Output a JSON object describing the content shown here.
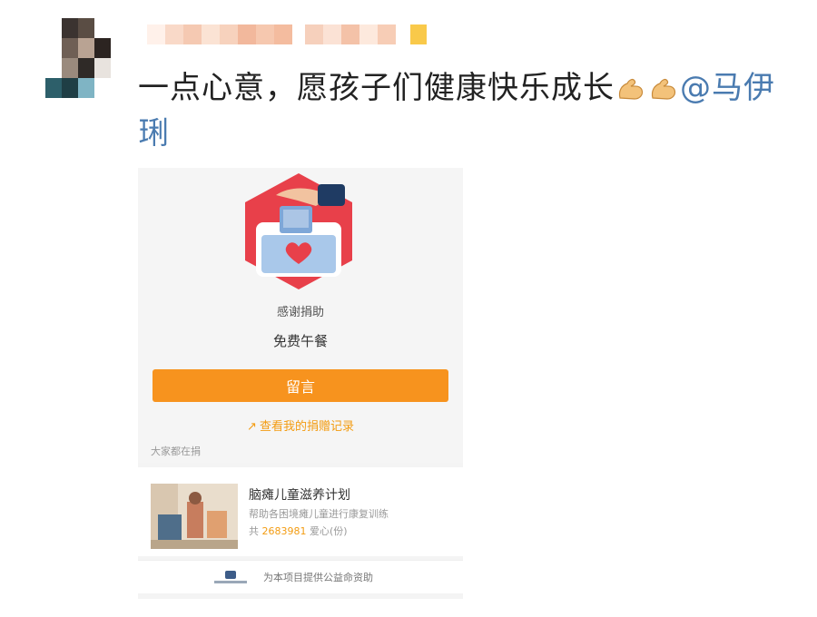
{
  "post": {
    "text": "一点心意，愿孩子们健康快乐成长",
    "mention": "@马伊琍",
    "emoji": "flexed-biceps-icon"
  },
  "card": {
    "thanks_label": "感谢捐助",
    "project_short": "免费午餐",
    "leave_message_button": "留言",
    "records_link": "查看我的捐赠记录",
    "everyone_label": "大家都在捐",
    "project": {
      "title": "脑瘫儿童滋养计划",
      "description": "帮助各困境瘫儿童进行康复训练",
      "count_prefix": "共",
      "count": "2683981",
      "count_suffix": "爱心(份)"
    },
    "sponsor_text": "为本项目提供公益命资助"
  },
  "colors": {
    "accent_orange": "#f7931e",
    "mention_blue": "#4a7bb0",
    "heart_red": "#e8404a"
  }
}
